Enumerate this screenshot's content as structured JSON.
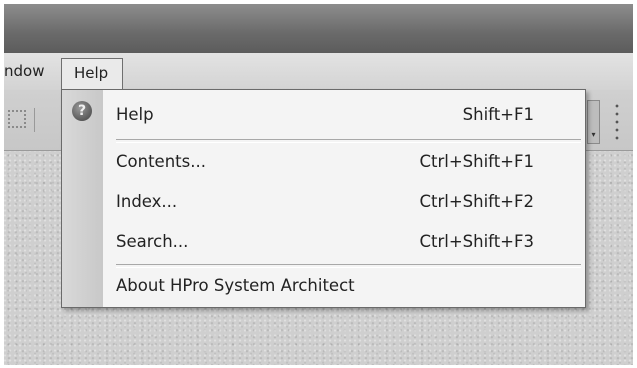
{
  "menubar": {
    "partial_item_label": "ndow",
    "help_label": "Help"
  },
  "help_menu": {
    "items": [
      {
        "label": "Help",
        "shortcut": "Shift+F1",
        "icon": "help-icon"
      },
      {
        "label": "Contents...",
        "shortcut": "Ctrl+Shift+F1"
      },
      {
        "label": "Index...",
        "shortcut": "Ctrl+Shift+F2"
      },
      {
        "label": "Search...",
        "shortcut": "Ctrl+Shift+F3"
      },
      {
        "label": "About HPro System Architect",
        "shortcut": ""
      }
    ]
  },
  "icons": {
    "help_icon_glyph": "?",
    "dropdown_glyph": "▾"
  }
}
